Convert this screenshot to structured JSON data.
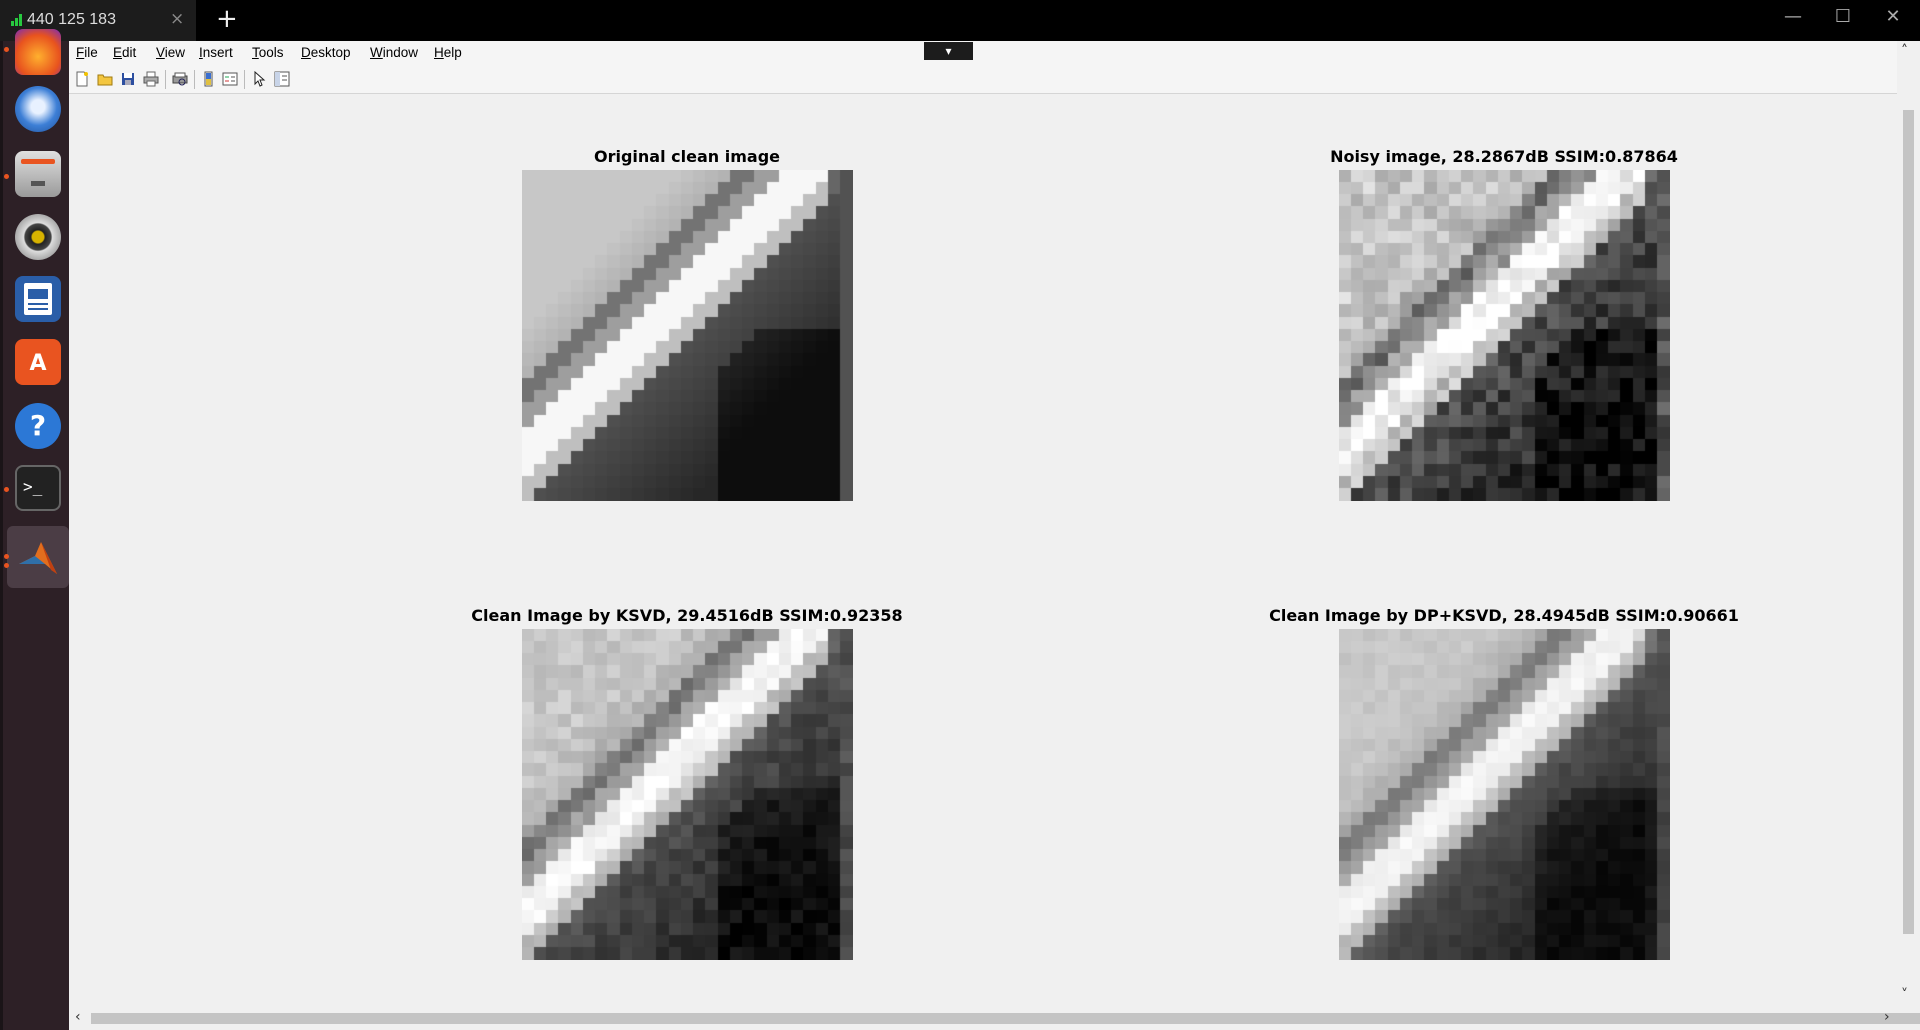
{
  "tab": {
    "title": "440 125 183",
    "close": "×",
    "new_tab": "+"
  },
  "window_controls": {
    "minimize": "—",
    "maximize": "☐",
    "close": "✕"
  },
  "dock": {
    "items": [
      {
        "name": "Firefox",
        "icon": "firefox-icon"
      },
      {
        "name": "Thunderbird",
        "icon": "thunderbird-icon"
      },
      {
        "name": "Files",
        "icon": "files-icon"
      },
      {
        "name": "Rhythmbox",
        "icon": "rhythmbox-icon"
      },
      {
        "name": "LibreOffice Writer",
        "icon": "writer-icon"
      },
      {
        "name": "Ubuntu Software",
        "icon": "software-icon"
      },
      {
        "name": "Help",
        "icon": "help-icon"
      },
      {
        "name": "Terminal",
        "icon": "terminal-icon"
      },
      {
        "name": "MATLAB",
        "icon": "matlab-icon"
      }
    ]
  },
  "menu": {
    "items": [
      {
        "label": "File",
        "key": "F",
        "rest": "ile"
      },
      {
        "label": "Edit",
        "key": "E",
        "rest": "dit"
      },
      {
        "label": "View",
        "key": "V",
        "rest": "iew"
      },
      {
        "label": "Insert",
        "key": "I",
        "rest": "nsert"
      },
      {
        "label": "Tools",
        "key": "T",
        "rest": "ools"
      },
      {
        "label": "Desktop",
        "key": "D",
        "rest": "esktop"
      },
      {
        "label": "Window",
        "key": "W",
        "rest": "indow"
      },
      {
        "label": "Help",
        "key": "H",
        "rest": "elp"
      }
    ],
    "collapse_icon": "chevron-down-icon"
  },
  "toolbar": {
    "buttons": [
      "new-figure-icon",
      "open-file-icon",
      "save-icon",
      "print-icon",
      "print-preview-icon",
      "colorbar-icon",
      "legend-icon",
      "edit-plot-icon",
      "property-editor-icon"
    ]
  },
  "plots": [
    {
      "title": "Original clean image",
      "noise": 0.0,
      "smooth": 0.0
    },
    {
      "title": "Noisy image, 28.2867dB SSIM:0.87864",
      "noise": 0.12,
      "smooth": 0.0
    },
    {
      "title": "Clean Image by KSVD, 29.4516dB SSIM:0.92358",
      "noise": 0.06,
      "smooth": 0.2
    },
    {
      "title": "Clean Image by DP+KSVD, 28.4945dB SSIM:0.90661",
      "noise": 0.03,
      "smooth": 0.4
    }
  ]
}
